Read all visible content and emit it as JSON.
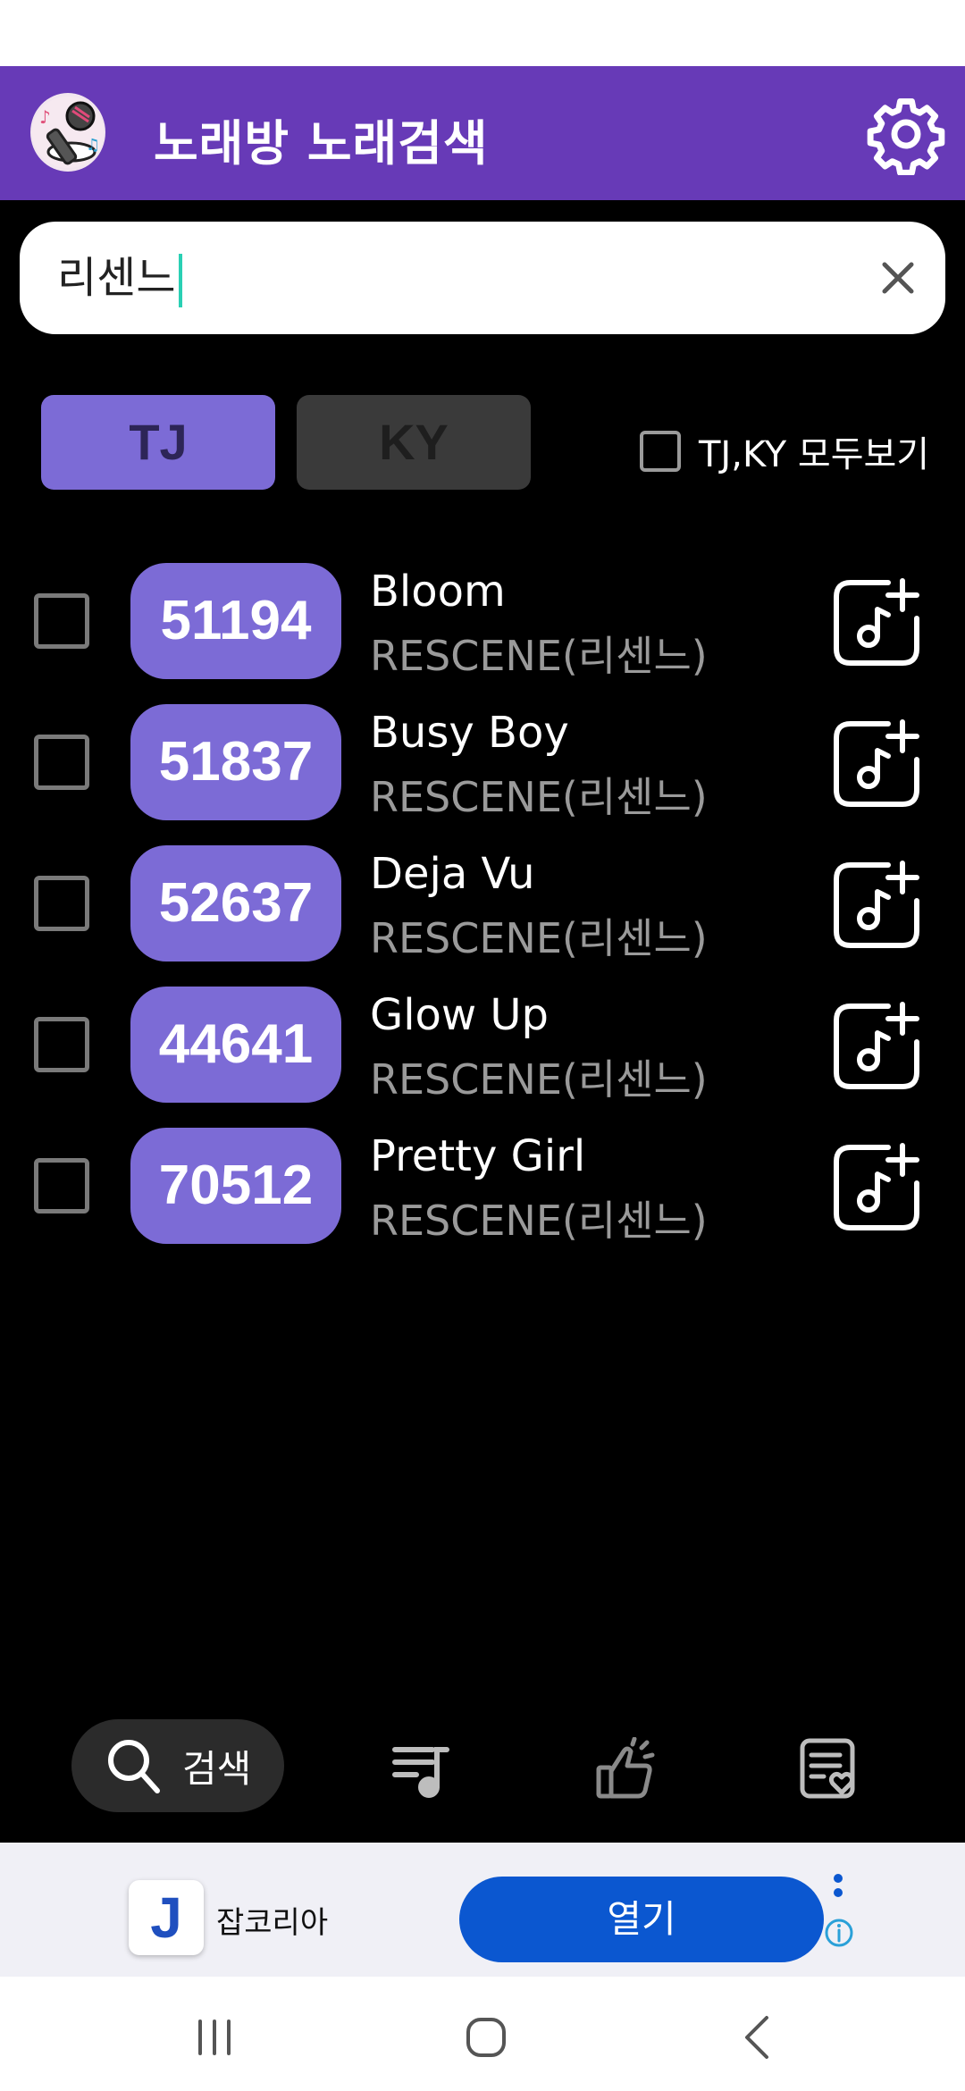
{
  "app": {
    "title": "노래방 노래검색"
  },
  "search": {
    "value": "리센느"
  },
  "tabs": {
    "tj": "TJ",
    "ky": "KY"
  },
  "show_all": {
    "label": "TJ,KY 모두보기"
  },
  "songs": [
    {
      "number": "51194",
      "title": "Bloom",
      "artist": "RESCENE(리센느)"
    },
    {
      "number": "51837",
      "title": "Busy Boy",
      "artist": "RESCENE(리센느)"
    },
    {
      "number": "52637",
      "title": "Deja Vu",
      "artist": "RESCENE(리센느)"
    },
    {
      "number": "44641",
      "title": "Glow Up",
      "artist": "RESCENE(리센느)"
    },
    {
      "number": "70512",
      "title": "Pretty Girl",
      "artist": "RESCENE(리센느)"
    }
  ],
  "bottom_nav": {
    "search_label": "검색"
  },
  "ad": {
    "name": "잡코리아",
    "logo_letter": "J",
    "open_label": "열기"
  },
  "colors": {
    "primary": "#673ab7",
    "accent": "#7c6bd6",
    "ad_button": "#0b57d0"
  },
  "icons": {
    "settings": "gear-icon",
    "clear": "close-icon",
    "add": "music-add-icon",
    "nav": [
      "search-icon",
      "playlist-icon",
      "thumbs-up-icon",
      "favorites-list-icon"
    ]
  }
}
